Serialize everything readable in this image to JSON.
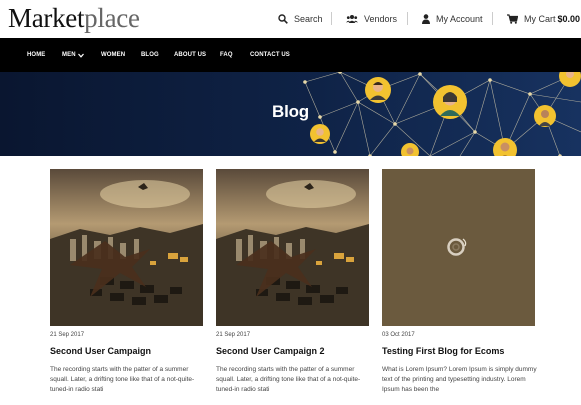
{
  "brand": {
    "name_dark": "Market",
    "name_light": "place"
  },
  "header": {
    "search_label": "Search",
    "vendors_label": "Vendors",
    "account_label": "My Account",
    "cart_label": "My Cart",
    "cart_total": "$0.00"
  },
  "nav": {
    "items": [
      "HOME",
      "MEN",
      "WOMEN",
      "BLOG",
      "ABOUT US",
      "FAQ",
      "CONTACT US"
    ]
  },
  "hero": {
    "title": "Blog"
  },
  "posts": [
    {
      "date": "21 Sep 2017",
      "title": "Second User Campaign",
      "excerpt": "The recording starts with the patter of a summer squall. Later, a drifting tone like that of a not-quite-tuned-in radio stati"
    },
    {
      "date": "21 Sep 2017",
      "title": "Second User Campaign 2",
      "excerpt": "The recording starts with the patter of a summer squall. Later, a drifting tone like that of a not-quite-tuned-in radio stati"
    },
    {
      "date": "03 Oct 2017",
      "title": "Testing First Blog for Ecoms",
      "excerpt": "What is Lorem Ipsum? Lorem Ipsum is simply dummy text of the printing and typesetting industry. Lorem Ipsum has been the"
    }
  ],
  "colors": {
    "nav_bg": "#000000",
    "hero_bg": "#0f2347",
    "loader_bg": "#6b5a3e"
  },
  "icons": [
    "search-icon",
    "users-icon",
    "user-icon",
    "cart-icon",
    "chevron-down-icon",
    "loading-spinner-icon"
  ]
}
